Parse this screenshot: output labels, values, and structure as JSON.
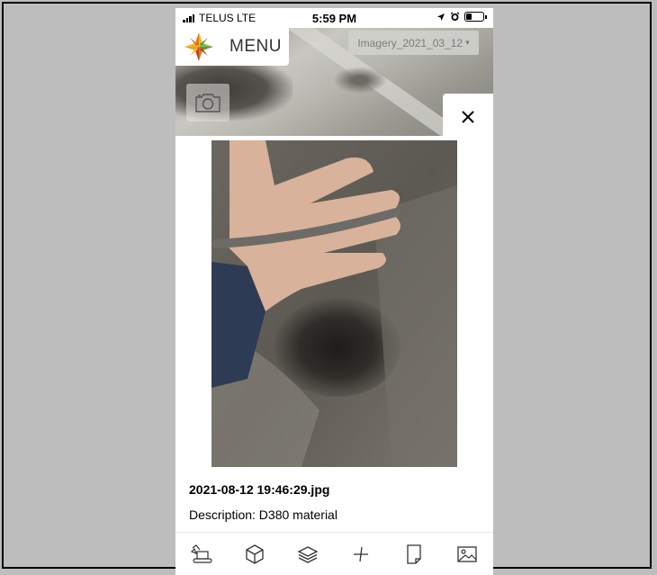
{
  "status_bar": {
    "carrier": "TELUS  LTE",
    "time": "5:59 PM",
    "location_icon": "location-arrow-icon",
    "alarm_icon": "alarm-clock-icon",
    "battery_icon": "battery-icon"
  },
  "header": {
    "menu_label": "MENU",
    "logo_icon": "star-compass-logo",
    "imagery_selector": "Imagery_2021_03_12",
    "imagery_caret_icon": "caret-down-icon"
  },
  "map": {
    "camera_icon": "camera-icon"
  },
  "photo_panel": {
    "close_icon": "close-icon",
    "filename": "2021-08-12 19:46:29.jpg",
    "description": "Description: D380 material"
  },
  "toolbar": {
    "items": [
      {
        "icon": "excavator-icon"
      },
      {
        "icon": "cube-icon"
      },
      {
        "icon": "layers-icon"
      },
      {
        "icon": "measure-icon"
      },
      {
        "icon": "document-icon"
      },
      {
        "icon": "image-icon"
      }
    ]
  },
  "colors": {
    "background": "#bdbdbd",
    "panel": "#ffffff",
    "text": "#000000",
    "imagery_text": "#7b7b7b",
    "logo_orange": "#e8731c",
    "logo_yellow": "#f2b61f",
    "logo_green": "#5a9a3a",
    "logo_red": "#c23a2a"
  }
}
